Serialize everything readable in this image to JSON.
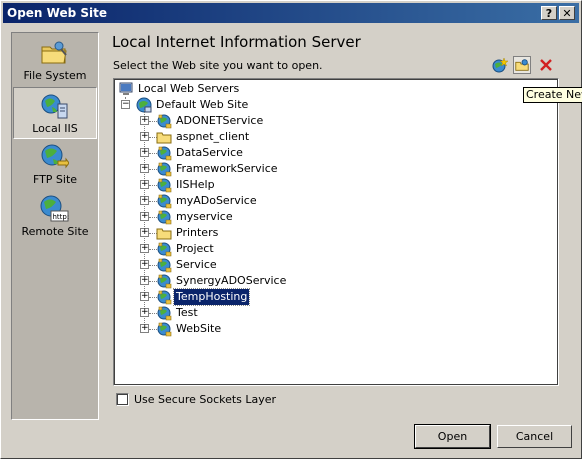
{
  "window": {
    "title": "Open Web Site",
    "help_label": "?",
    "close_label": "✕"
  },
  "places": [
    {
      "label": "File System",
      "icon": "folder-icon",
      "selected": false
    },
    {
      "label": "Local IIS",
      "icon": "local-iis-icon",
      "selected": true
    },
    {
      "label": "FTP Site",
      "icon": "ftp-globe-icon",
      "selected": false
    },
    {
      "label": "Remote Site",
      "icon": "http-globe-icon",
      "selected": false
    }
  ],
  "main": {
    "heading": "Local Internet Information Server",
    "instruction": "Select the Web site you want to open."
  },
  "toolbar": {
    "tooltip": "Create New"
  },
  "tree": {
    "root": "Local Web Servers",
    "site": "Default Web Site",
    "children": [
      {
        "label": "ADONETService",
        "type": "app"
      },
      {
        "label": "aspnet_client",
        "type": "folder"
      },
      {
        "label": "DataService",
        "type": "app"
      },
      {
        "label": "FrameworkService",
        "type": "app"
      },
      {
        "label": "IISHelp",
        "type": "app"
      },
      {
        "label": "myADoService",
        "type": "app"
      },
      {
        "label": "myservice",
        "type": "app"
      },
      {
        "label": "Printers",
        "type": "folder"
      },
      {
        "label": "Project",
        "type": "app"
      },
      {
        "label": "Service",
        "type": "app"
      },
      {
        "label": "SynergyADOService",
        "type": "app"
      },
      {
        "label": "TempHosting",
        "type": "app",
        "selected": true
      },
      {
        "label": "Test",
        "type": "app"
      },
      {
        "label": "WebSite",
        "type": "app"
      }
    ]
  },
  "options": {
    "ssl_label": "Use Secure Sockets Layer",
    "ssl_checked": false
  },
  "buttons": {
    "open": "Open",
    "cancel": "Cancel"
  },
  "colors": {
    "title_bar": "#0a246a",
    "selection": "#0a246a",
    "tooltip_bg": "#ffffe1"
  }
}
